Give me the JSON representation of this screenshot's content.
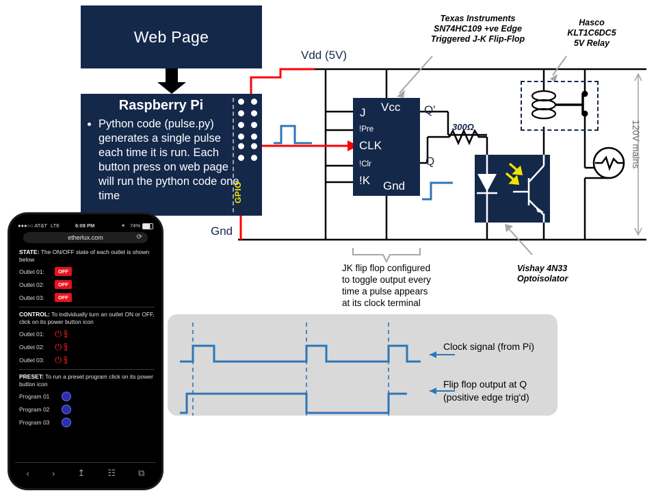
{
  "webpage_block": {
    "title": "Web Page"
  },
  "pi_block": {
    "title": "Raspberry Pi",
    "bullets": [
      "Python code (pulse.py) generates a single pulse each time it is run. Each button press on web page will run the python code one time"
    ],
    "gpio_label": "GPIO"
  },
  "circuit": {
    "vdd_label": "Vdd (5V)",
    "gnd_label": "Gnd",
    "resistor_label": "300Ω",
    "mains_label": "120V mains",
    "ic": {
      "pins_left": [
        "J",
        "!Pre",
        "CLK",
        "!Clr",
        "!K"
      ],
      "pin_vcc": "Vcc",
      "pin_gnd": "Gnd",
      "pin_qbar": "Q'",
      "pin_q": "Q"
    }
  },
  "annotations": {
    "flipflop_part": "Texas Instruments\nSN74HC109 +ve Edge\nTriggered J-K Flip-Flop",
    "flipflop_part_lines": [
      "Texas Instruments",
      "SN74HC109 +ve Edge",
      "Triggered J-K Flip-Flop"
    ],
    "relay_part_lines": [
      "Hasco",
      "KLT1C6DC5",
      "5V Relay"
    ],
    "opto_part_lines": [
      "Vishay 4N33",
      "Optoisolator"
    ],
    "flipflop_caption_lines": [
      "JK flip flop configured",
      "to toggle output every",
      "time a pulse appears",
      "at its clock terminal"
    ]
  },
  "timing": {
    "clock_caption": "Clock signal (from Pi)",
    "q_caption_lines": [
      "Flip flop output at Q",
      "(positive edge trig'd)"
    ]
  },
  "phone": {
    "status": {
      "carrier": "●●●○○ AT&T",
      "network": "LTE",
      "time": "6:08 PM",
      "bluetooth": "✶",
      "battery": "74%"
    },
    "url": "etherlux.com",
    "reload_icon": "⟳",
    "state_section": {
      "label": "STATE:",
      "text": "The ON/OFF state of each outlet is shown below",
      "rows": [
        {
          "name": "Outlet 01:",
          "value": "OFF"
        },
        {
          "name": "Outlet 02:",
          "value": "OFF"
        },
        {
          "name": "Outlet 03:",
          "value": "OFF"
        }
      ]
    },
    "control_section": {
      "label": "CONTROL:",
      "text": "To individually turn an outlet ON or OFF, click on its power button icon",
      "rows": [
        {
          "name": "Outlet 01:",
          "state": "OFF"
        },
        {
          "name": "Outlet 02:",
          "state": "OFF"
        },
        {
          "name": "Outlet 03:",
          "state": "OFF"
        }
      ]
    },
    "preset_section": {
      "label": "PRESET:",
      "text": "To run a preset program click on its power button icon",
      "rows": [
        {
          "name": "Program 01"
        },
        {
          "name": "Program 02"
        },
        {
          "name": "Program 03"
        }
      ]
    },
    "toolbar": {
      "back": "‹",
      "forward": "›",
      "share": "⇧",
      "bookmarks": "□□",
      "tabs": "⧉"
    }
  },
  "colors": {
    "navy": "#14284a",
    "red_wire": "#ff0000",
    "blue_signal": "#2e75b6",
    "gpio_yellow": "#ffe600",
    "panel_gray": "#d9d9d9",
    "off_red": "#e8121d"
  }
}
